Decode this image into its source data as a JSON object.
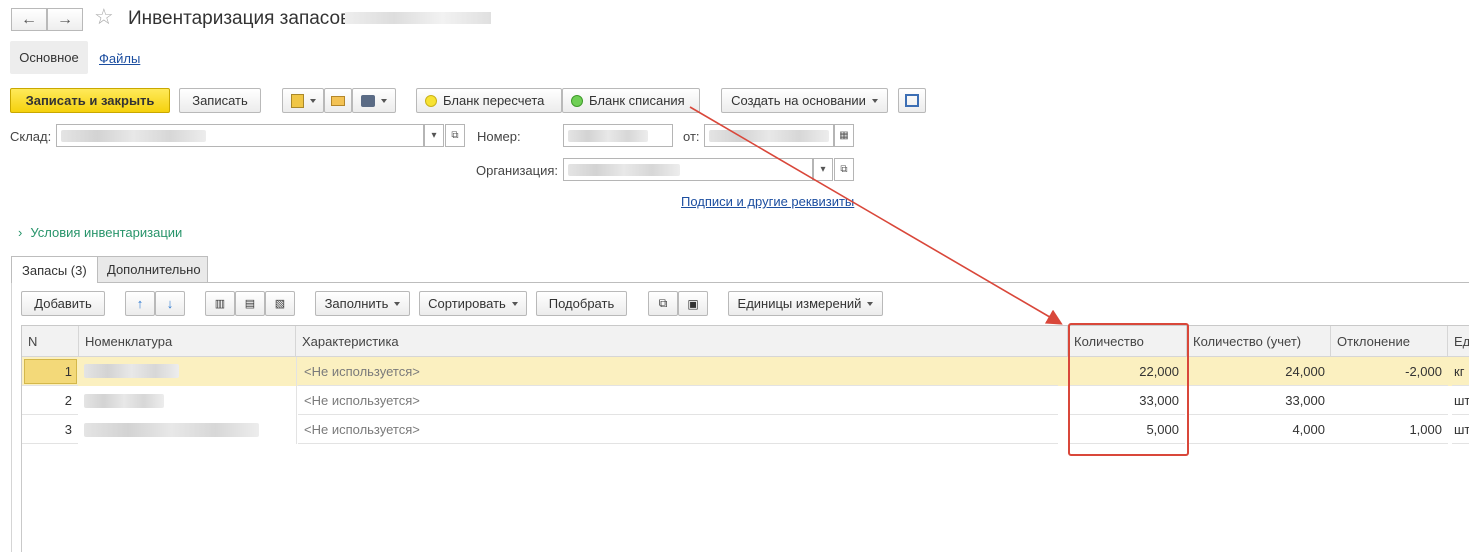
{
  "window": {
    "title": "Инвентаризация запасов",
    "back_icon": "←",
    "forward_icon": "→",
    "star_icon": "☆"
  },
  "nav_tabs": [
    {
      "label": "Основное"
    },
    {
      "label": "Файлы"
    }
  ],
  "toolbar": {
    "save_close_label": "Записать и закрыть",
    "save_label": "Записать",
    "recount_form_label": "Бланк пересчета",
    "writeoff_form_label": "Бланк списания",
    "create_based_label": "Создать на основании"
  },
  "form": {
    "warehouse_label": "Склад:",
    "number_label": "Номер:",
    "date_label": "от:",
    "organization_label": "Организация:",
    "signatures_link": "Подписи и другие реквизиты",
    "conditions_label": "Условия инвентаризации"
  },
  "tabs": [
    {
      "label": "Запасы (3)"
    },
    {
      "label": "Дополнительно"
    }
  ],
  "table_toolbar": {
    "add_label": "Добавить",
    "fill_label": "Заполнить",
    "sort_label": "Сортировать",
    "select_label": "Подобрать",
    "units_label": "Единицы измерений"
  },
  "table": {
    "columns": [
      "N",
      "Номенклатура",
      "Характеристика",
      "Количество",
      "Количество (учет)",
      "Отклонение",
      "Ед"
    ],
    "rows": [
      {
        "n": "1",
        "characteristic": "<Не используется>",
        "qty": "22,000",
        "qty_acc": "24,000",
        "deviation": "-2,000",
        "unit": "кг"
      },
      {
        "n": "2",
        "characteristic": "<Не используется>",
        "qty": "33,000",
        "qty_acc": "33,000",
        "deviation": "",
        "unit": "шт"
      },
      {
        "n": "3",
        "characteristic": "<Не используется>",
        "qty": "5,000",
        "qty_acc": "4,000",
        "deviation": "1,000",
        "unit": "шт"
      }
    ]
  },
  "colors": {
    "primary_button": "#f5d10d",
    "selected_row": "#fbf0c0",
    "annotation_red": "#d9473a",
    "link": "#1c4ea0",
    "conditions_green": "#27946a"
  }
}
